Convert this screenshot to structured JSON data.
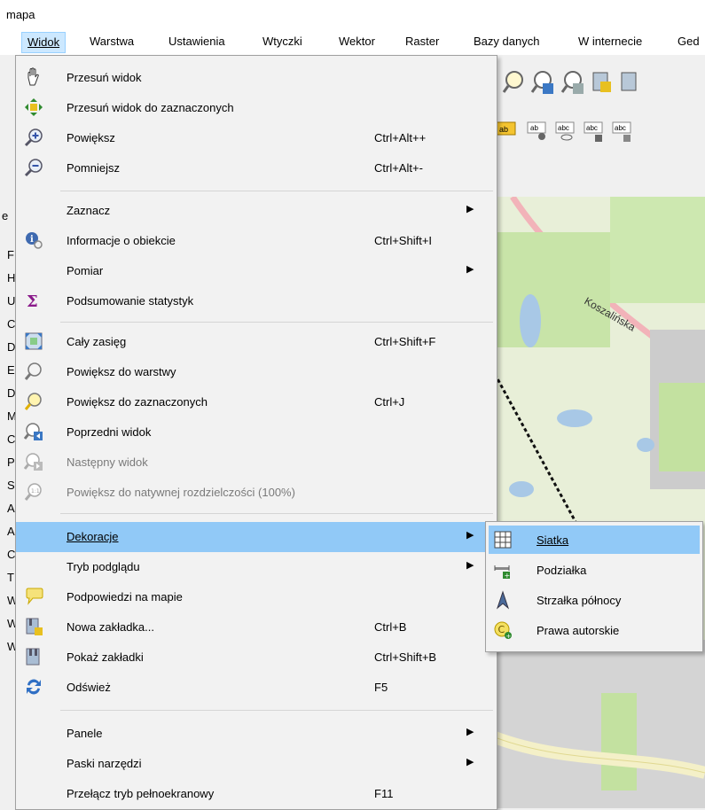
{
  "window": {
    "title": "mapa"
  },
  "menubar": {
    "items": [
      {
        "label": "Widok"
      },
      {
        "label": "Warstwa"
      },
      {
        "label": "Ustawienia"
      },
      {
        "label": "Wtyczki"
      },
      {
        "label": "Wektor"
      },
      {
        "label": "Raster"
      },
      {
        "label": "Bazy danych"
      },
      {
        "label": "W internecie"
      },
      {
        "label": "Ged"
      }
    ]
  },
  "left_panel": {
    "letters": [
      "e",
      "F",
      "H",
      "U",
      "C",
      "D",
      "E",
      "D",
      "M",
      "C",
      "P",
      "S",
      "A",
      "A",
      "C",
      "T",
      "W",
      "W",
      "W"
    ]
  },
  "menu": {
    "items": [
      {
        "label": "Przesuń widok",
        "shortcut": "",
        "icon": "pan-hand-icon"
      },
      {
        "label": "Przesuń widok do zaznaczonych",
        "shortcut": "",
        "icon": "pan-to-selected-icon"
      },
      {
        "label": "Powiększ",
        "shortcut": "Ctrl+Alt++",
        "icon": "zoom-in-icon"
      },
      {
        "label": "Pomniejsz",
        "shortcut": "Ctrl+Alt+-",
        "icon": "zoom-out-icon"
      },
      {
        "label": "Zaznacz",
        "shortcut": "",
        "icon": ""
      },
      {
        "label": "Informacje o obiekcie",
        "shortcut": "Ctrl+Shift+I",
        "icon": "identify-icon"
      },
      {
        "label": "Pomiar",
        "shortcut": "",
        "icon": ""
      },
      {
        "label": "Podsumowanie statystyk",
        "shortcut": "",
        "icon": "sigma-icon"
      },
      {
        "label": "Cały zasięg",
        "shortcut": "Ctrl+Shift+F",
        "icon": "zoom-full-icon"
      },
      {
        "label": "Powiększ do warstwy",
        "shortcut": "",
        "icon": "zoom-layer-icon"
      },
      {
        "label": "Powiększ do zaznaczonych",
        "shortcut": "Ctrl+J",
        "icon": "zoom-selected-icon"
      },
      {
        "label": "Poprzedni widok",
        "shortcut": "",
        "icon": "zoom-last-icon"
      },
      {
        "label": "Następny widok",
        "shortcut": "",
        "icon": "zoom-next-icon"
      },
      {
        "label": "Powiększ do natywnej rozdzielczości (100%)",
        "shortcut": "",
        "icon": "zoom-native-icon"
      },
      {
        "label": "Dekoracje",
        "shortcut": "",
        "icon": ""
      },
      {
        "label": "Tryb podglądu",
        "shortcut": "",
        "icon": ""
      },
      {
        "label": "Podpowiedzi na mapie",
        "shortcut": "",
        "icon": "map-tips-icon"
      },
      {
        "label": "Nowa zakładka...",
        "shortcut": "Ctrl+B",
        "icon": "new-bookmark-icon"
      },
      {
        "label": "Pokaż zakładki",
        "shortcut": "Ctrl+Shift+B",
        "icon": "show-bookmarks-icon"
      },
      {
        "label": "Odśwież",
        "shortcut": "F5",
        "icon": "refresh-icon"
      },
      {
        "label": "Panele",
        "shortcut": "",
        "icon": ""
      },
      {
        "label": "Paski narzędzi",
        "shortcut": "",
        "icon": ""
      },
      {
        "label": "Przełącz tryb pełnoekranowy",
        "shortcut": "F11",
        "icon": ""
      }
    ]
  },
  "submenu": {
    "items": [
      {
        "label": "Siatka",
        "icon": "grid-icon"
      },
      {
        "label": "Podziałka",
        "icon": "scale-bar-icon"
      },
      {
        "label": "Strzałka północy",
        "icon": "north-arrow-icon"
      },
      {
        "label": "Prawa autorskie",
        "icon": "copyright-icon"
      }
    ]
  },
  "map": {
    "labels": [
      "Koszalińska"
    ]
  },
  "colors": {
    "highlight": "#91c9f7",
    "menu_bg": "#f2f2f2",
    "menubar_active": "#cce8ff"
  }
}
